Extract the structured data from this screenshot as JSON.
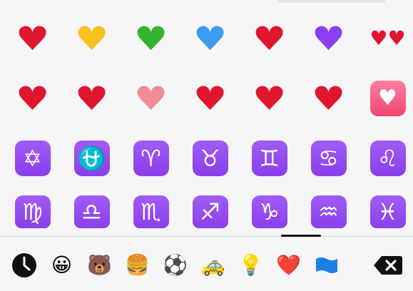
{
  "emoji_grid": {
    "rows": [
      [
        {
          "name": "red-heart",
          "glyph": "♥"
        },
        {
          "name": "yellow-heart",
          "glyph": "♥"
        },
        {
          "name": "green-heart",
          "glyph": "♥"
        },
        {
          "name": "blue-heart",
          "glyph": "♥"
        },
        {
          "name": "broken-heart",
          "glyph": "♥"
        },
        {
          "name": "purple-heart",
          "glyph": "♥"
        },
        {
          "name": "two-hearts",
          "glyph": "♥♥"
        }
      ],
      [
        {
          "name": "beating-heart",
          "glyph": "♥"
        },
        {
          "name": "revolving-hearts",
          "glyph": "♥"
        },
        {
          "name": "growing-heart",
          "glyph": "♥"
        },
        {
          "name": "heart-with-arrow",
          "glyph": "♥"
        },
        {
          "name": "sparkling-heart",
          "glyph": "♥"
        },
        {
          "name": "heart-with-ribbon",
          "glyph": "♥"
        },
        {
          "name": "heart-decoration",
          "glyph": "♥"
        }
      ],
      [
        {
          "name": "star-of-david",
          "glyph": "✡"
        },
        {
          "name": "ophiuchus",
          "glyph": "⛎"
        },
        {
          "name": "aries",
          "glyph": "♈"
        },
        {
          "name": "taurus",
          "glyph": "♉"
        },
        {
          "name": "gemini",
          "glyph": "♊"
        },
        {
          "name": "cancer",
          "glyph": "♋"
        },
        {
          "name": "leo",
          "glyph": "♌"
        }
      ],
      [
        {
          "name": "virgo",
          "glyph": "♍"
        },
        {
          "name": "libra",
          "glyph": "♎"
        },
        {
          "name": "scorpio",
          "glyph": "♏"
        },
        {
          "name": "sagittarius",
          "glyph": "♐"
        },
        {
          "name": "capricorn",
          "glyph": "♑"
        },
        {
          "name": "aquarius",
          "glyph": "♒"
        },
        {
          "name": "pisces",
          "glyph": "♓"
        }
      ]
    ]
  },
  "categories": [
    {
      "name": "recent",
      "glyph": ""
    },
    {
      "name": "smileys",
      "glyph": "😀"
    },
    {
      "name": "animals",
      "glyph": "🐻"
    },
    {
      "name": "food",
      "glyph": "🍔"
    },
    {
      "name": "activity",
      "glyph": "⚽"
    },
    {
      "name": "travel",
      "glyph": "🚕"
    },
    {
      "name": "objects",
      "glyph": "💡"
    },
    {
      "name": "symbols",
      "glyph": "❤️"
    },
    {
      "name": "flags",
      "glyph": "🏴"
    }
  ],
  "colors": {
    "red": "#e0152e",
    "yellow": "#f7c321",
    "green": "#36b32c",
    "blue": "#3a9bf0",
    "purple": "#8c3ff0",
    "zodiac_tile": "#9a52f5",
    "pink_tile": "#f4587c",
    "active_category": "#111111"
  },
  "active_category": "symbols"
}
